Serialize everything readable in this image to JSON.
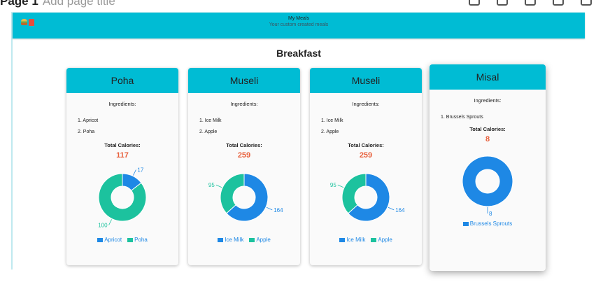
{
  "editor": {
    "page_name": "Page 1",
    "page_title_placeholder": "Add page title"
  },
  "header": {
    "title": "My Meals",
    "subtitle": "Your custom created meals"
  },
  "section_title": "Breakfast",
  "labels": {
    "ingredients": "Ingredients:",
    "total_calories": "Total Calories:"
  },
  "colors": {
    "header": "#00bcd4",
    "calorie_value": "#e8603c",
    "series_blue": "#1e88e5",
    "series_green": "#1cc29e"
  },
  "meals": [
    {
      "name": "Poha",
      "ingredients": [
        "1. Apricot",
        "2. Poha"
      ],
      "total_calories": "117",
      "chart": {
        "series": [
          {
            "name": "Apricot",
            "value": 17,
            "color": "#1e88e5"
          },
          {
            "name": "Poha",
            "value": 100,
            "color": "#1cc29e"
          }
        ]
      }
    },
    {
      "name": "Museli",
      "ingredients": [
        "1. Ice Milk",
        "2. Apple"
      ],
      "total_calories": "259",
      "chart": {
        "series": [
          {
            "name": "Ice Milk",
            "value": 164,
            "color": "#1e88e5"
          },
          {
            "name": "Apple",
            "value": 95,
            "color": "#1cc29e"
          }
        ]
      }
    },
    {
      "name": "Museli",
      "ingredients": [
        "1. Ice Milk",
        "2. Apple"
      ],
      "total_calories": "259",
      "chart": {
        "series": [
          {
            "name": "Ice Milk",
            "value": 164,
            "color": "#1e88e5"
          },
          {
            "name": "Apple",
            "value": 95,
            "color": "#1cc29e"
          }
        ]
      }
    },
    {
      "name": "Misal",
      "ingredients": [
        "1. Brussels Sprouts"
      ],
      "total_calories": "8",
      "chart": {
        "series": [
          {
            "name": "Brussels Sprouts",
            "value": 8,
            "color": "#1e88e5"
          }
        ]
      }
    }
  ]
}
